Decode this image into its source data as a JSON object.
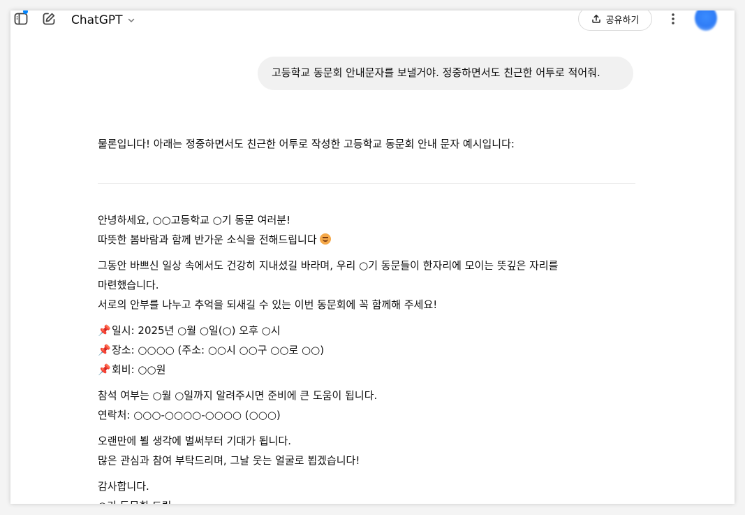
{
  "header": {
    "model_name": "ChatGPT",
    "share_label": "공유하기"
  },
  "conversation": {
    "user_message": "고등학교 동문회 안내문자를 보낼거야. 정중하면서도 친근한 어투로 적어줘.",
    "assistant": {
      "intro": "물론입니다! 아래는 정중하면서도 친근한 어투로 작성한 고등학교 동문회 안내 문자 예시입니다:",
      "greeting_1": "안녕하세요, ○○고등학교 ○기 동문 여러분!",
      "greeting_2": "따뜻한 봄바람과 함께 반가운 소식을 전해드립니다",
      "body_1": "그동안 바쁘신 일상 속에서도 건강히 지내셨길 바라며, 우리 ○기 동문들이 한자리에 모이는 뜻깊은 자리를",
      "body_2": "마련했습니다.",
      "body_3": "서로의 안부를 나누고 추억을 되새길 수 있는 이번 동문회에 꼭 함께해 주세요!",
      "pin_icon": "📌",
      "details": [
        "일시: 2025년 ○월 ○일(○) 오후 ○시",
        "장소: ○○○○ (주소: ○○시 ○○구 ○○로 ○○)",
        "회비: ○○원"
      ],
      "rsvp_1": "참석 여부는 ○월 ○일까지 알려주시면 준비에 큰 도움이 됩니다.",
      "rsvp_2": "연락처: ○○○-○○○○-○○○○ (○○○)",
      "closing_1": "오랜만에 뵐 생각에 벌써부터 기대가 됩니다.",
      "closing_2": "많은 관심과 참여 부탁드리며, 그날 웃는 얼굴로 뵙겠습니다!",
      "signoff_1": "감사합니다.",
      "signoff_2": "○기 동문회 드림"
    }
  },
  "colors": {
    "accent_dot": "#0285ff",
    "bubble_bg": "#f1f1f1"
  }
}
